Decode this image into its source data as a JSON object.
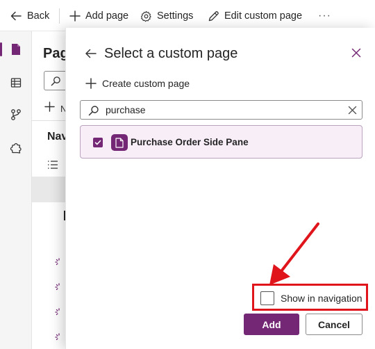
{
  "topbar": {
    "back_label": "Back",
    "add_page_label": "Add page",
    "settings_label": "Settings",
    "edit_custom_page_label": "Edit custom page",
    "more_label": "···"
  },
  "background_panel": {
    "title": "Pag",
    "new_label": "N",
    "nav_heading": "Nav"
  },
  "dialog": {
    "title": "Select a custom page",
    "create_label": "Create custom page",
    "search": {
      "value": "purchase"
    },
    "results": [
      {
        "label": "Purchase Order Side Pane",
        "selected": true
      }
    ],
    "show_in_navigation": {
      "label": "Show in navigation",
      "checked": false
    },
    "add_button": "Add",
    "cancel_button": "Cancel"
  },
  "colors": {
    "accent": "#742774",
    "selected_row_bg": "#f7eef7",
    "annotation_red": "#e0151c"
  }
}
